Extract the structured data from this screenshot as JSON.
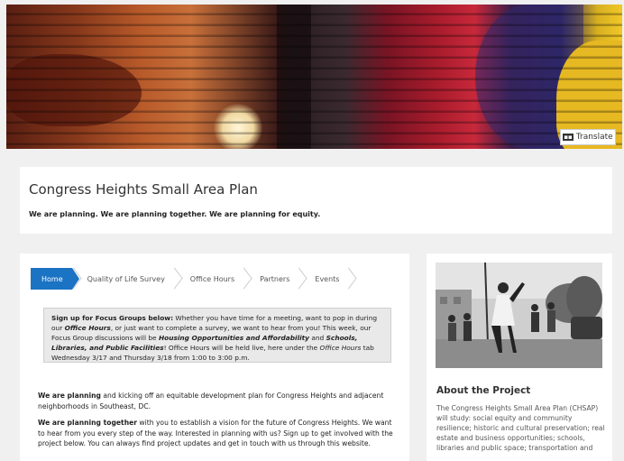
{
  "header": {
    "translate_label": "Translate"
  },
  "title_card": {
    "title": "Congress Heights Small Area Plan",
    "tagline": "We are planning. We are planning together. We are planning for equity."
  },
  "tabs": [
    {
      "label": "Home",
      "active": true
    },
    {
      "label": "Quality of Life Survey",
      "active": false
    },
    {
      "label": "Office Hours",
      "active": false
    },
    {
      "label": "Partners",
      "active": false
    },
    {
      "label": "Events",
      "active": false
    }
  ],
  "notice": {
    "lead": "Sign up for Focus Groups below:",
    "t1": " Whether you have time for a meeting, want to pop in during our ",
    "office_hours_1": "Office Hours",
    "t2": ", or just want to complete a survey, we want to hear from you! This week, our Focus Group discussions will be ",
    "topic1": "Housing Opportunities and Affordability",
    "t3": " and ",
    "topic2": "Schools, Libraries, and Public Facilities",
    "t4": "! Office Hours will be held live, here under the ",
    "office_hours_2": "Office Hours",
    "t5": " tab Wednesday 3/17 and Thursday 3/18 from 1:00 to 3:00 p.m."
  },
  "body": {
    "p1_bold": "We are planning",
    "p1_text": " and kicking off an equitable development plan for Congress Heights and adjacent neighborhoods in Southeast, DC.",
    "p2_bold": "We are planning together",
    "p2_text": " with you to establish a vision for the future of Congress Heights. We want to hear from you every step of the way. Interested in planning with us? Sign up to get involved with the project below. You can always find project updates and get in touch with us through this website."
  },
  "sidebar": {
    "about_title": "About the Project",
    "about_text": "The Congress Heights Small Area Plan (CHSAP) will study: social equity and community resilience; historic and cultural preservation; real estate and business opportunities; schools, libraries and public space; transportation and"
  }
}
